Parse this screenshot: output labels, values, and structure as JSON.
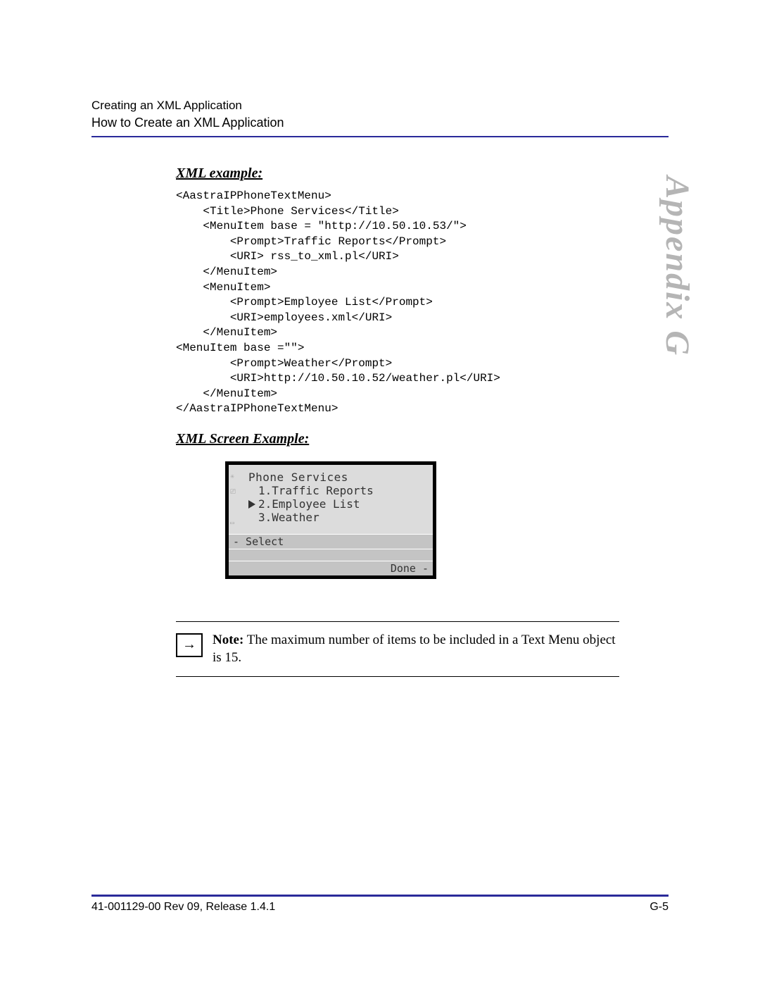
{
  "header": {
    "line1": "Creating an XML Application",
    "line2": "How to Create an XML Application"
  },
  "side_label": "Appendix G",
  "sections": {
    "xml_example_head": "XML example:",
    "xml_screen_head": "XML Screen Example:"
  },
  "code": "<AastraIPPhoneTextMenu>\n    <Title>Phone Services</Title>\n    <MenuItem base = \"http://10.50.10.53/\">\n        <Prompt>Traffic Reports</Prompt>\n        <URI> rss_to_xml.pl</URI>\n    </MenuItem>\n    <MenuItem>\n        <Prompt>Employee List</Prompt>\n        <URI>employees.xml</URI>\n    </MenuItem>\n<MenuItem base =\"\">\n        <Prompt>Weather</Prompt>\n        <URI>http://10.50.10.52/weather.pl</URI>\n    </MenuItem>\n</AastraIPPhoneTextMenu>",
  "screen": {
    "title": "Phone Services",
    "items": [
      "1.Traffic Reports",
      "2.Employee List",
      "3.Weather"
    ],
    "selected_index": 1,
    "softkeys": {
      "left1": "- Select",
      "right3": "Done -"
    }
  },
  "note": {
    "label": "Note:",
    "text": " The maximum number of items to be included in a Text Menu object is 15."
  },
  "footer": {
    "left": "41-001129-00 Rev 09, Release 1.4.1",
    "right": "G-5"
  }
}
